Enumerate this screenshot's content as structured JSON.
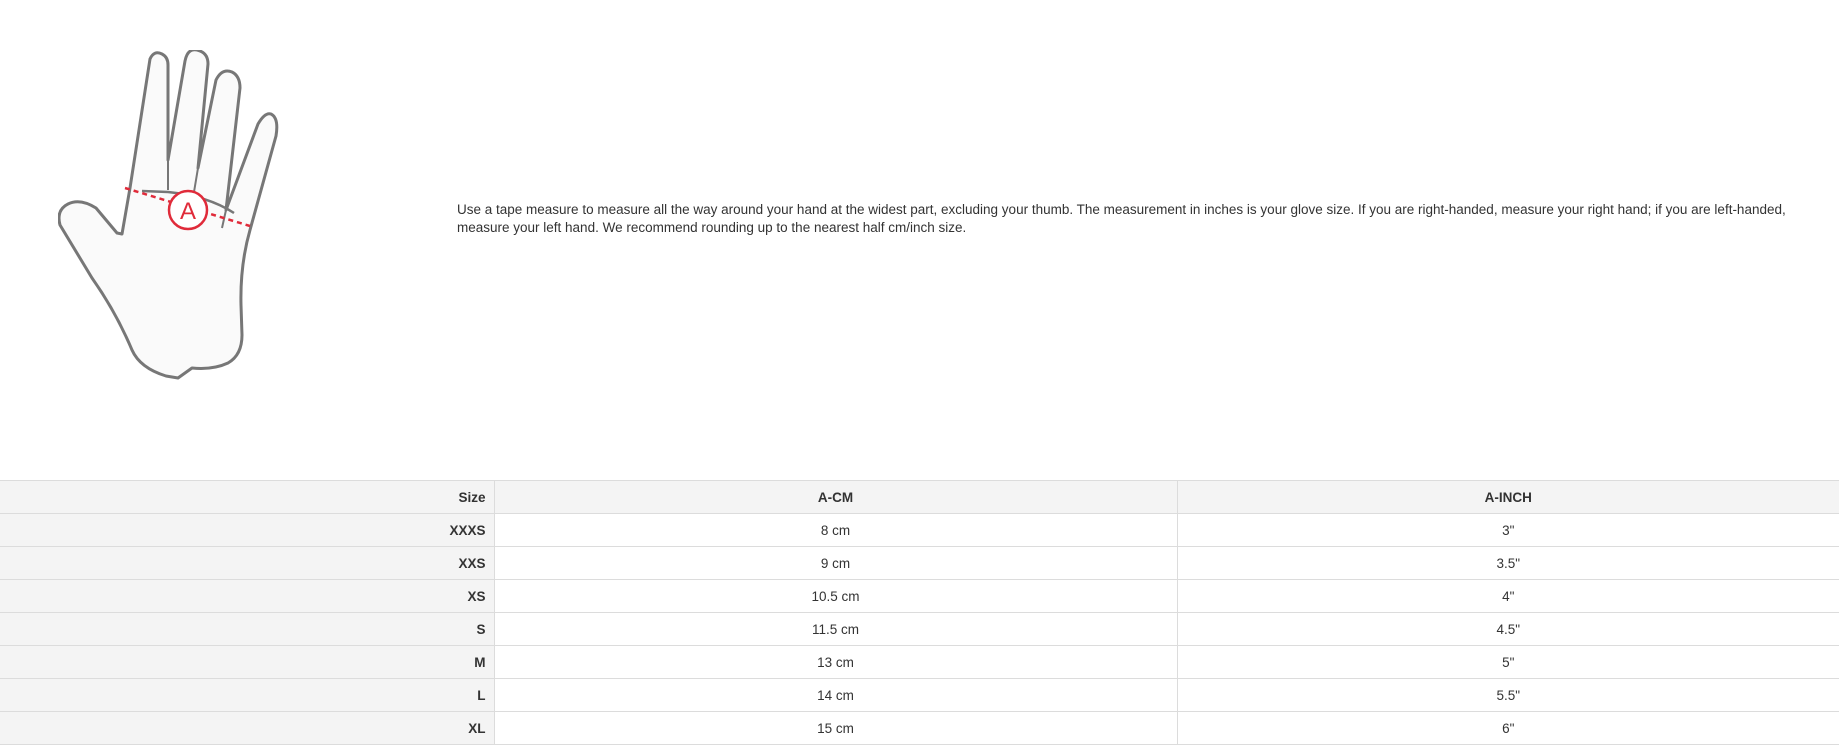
{
  "figure": {
    "marker_label": "A",
    "measure_color": "#e02b3a"
  },
  "instructions": "Use a tape measure to measure all the way around your hand at the widest part, excluding your thumb. The measurement in inches is your glove size. If you are right-handed, measure your right hand; if you are left-handed, measure your left hand. We recommend rounding up to the nearest half cm/inch size.",
  "table": {
    "headers": [
      "Size",
      "A-CM",
      "A-INCH"
    ],
    "rows": [
      {
        "size": "XXXS",
        "cm": "8 cm",
        "inch": "3\""
      },
      {
        "size": "XXS",
        "cm": "9 cm",
        "inch": "3.5\""
      },
      {
        "size": "XS",
        "cm": "10.5 cm",
        "inch": "4\""
      },
      {
        "size": "S",
        "cm": "11.5 cm",
        "inch": "4.5\""
      },
      {
        "size": "M",
        "cm": "13 cm",
        "inch": "5\""
      },
      {
        "size": "L",
        "cm": "14 cm",
        "inch": "5.5\""
      },
      {
        "size": "XL",
        "cm": "15 cm",
        "inch": "6\""
      }
    ]
  }
}
